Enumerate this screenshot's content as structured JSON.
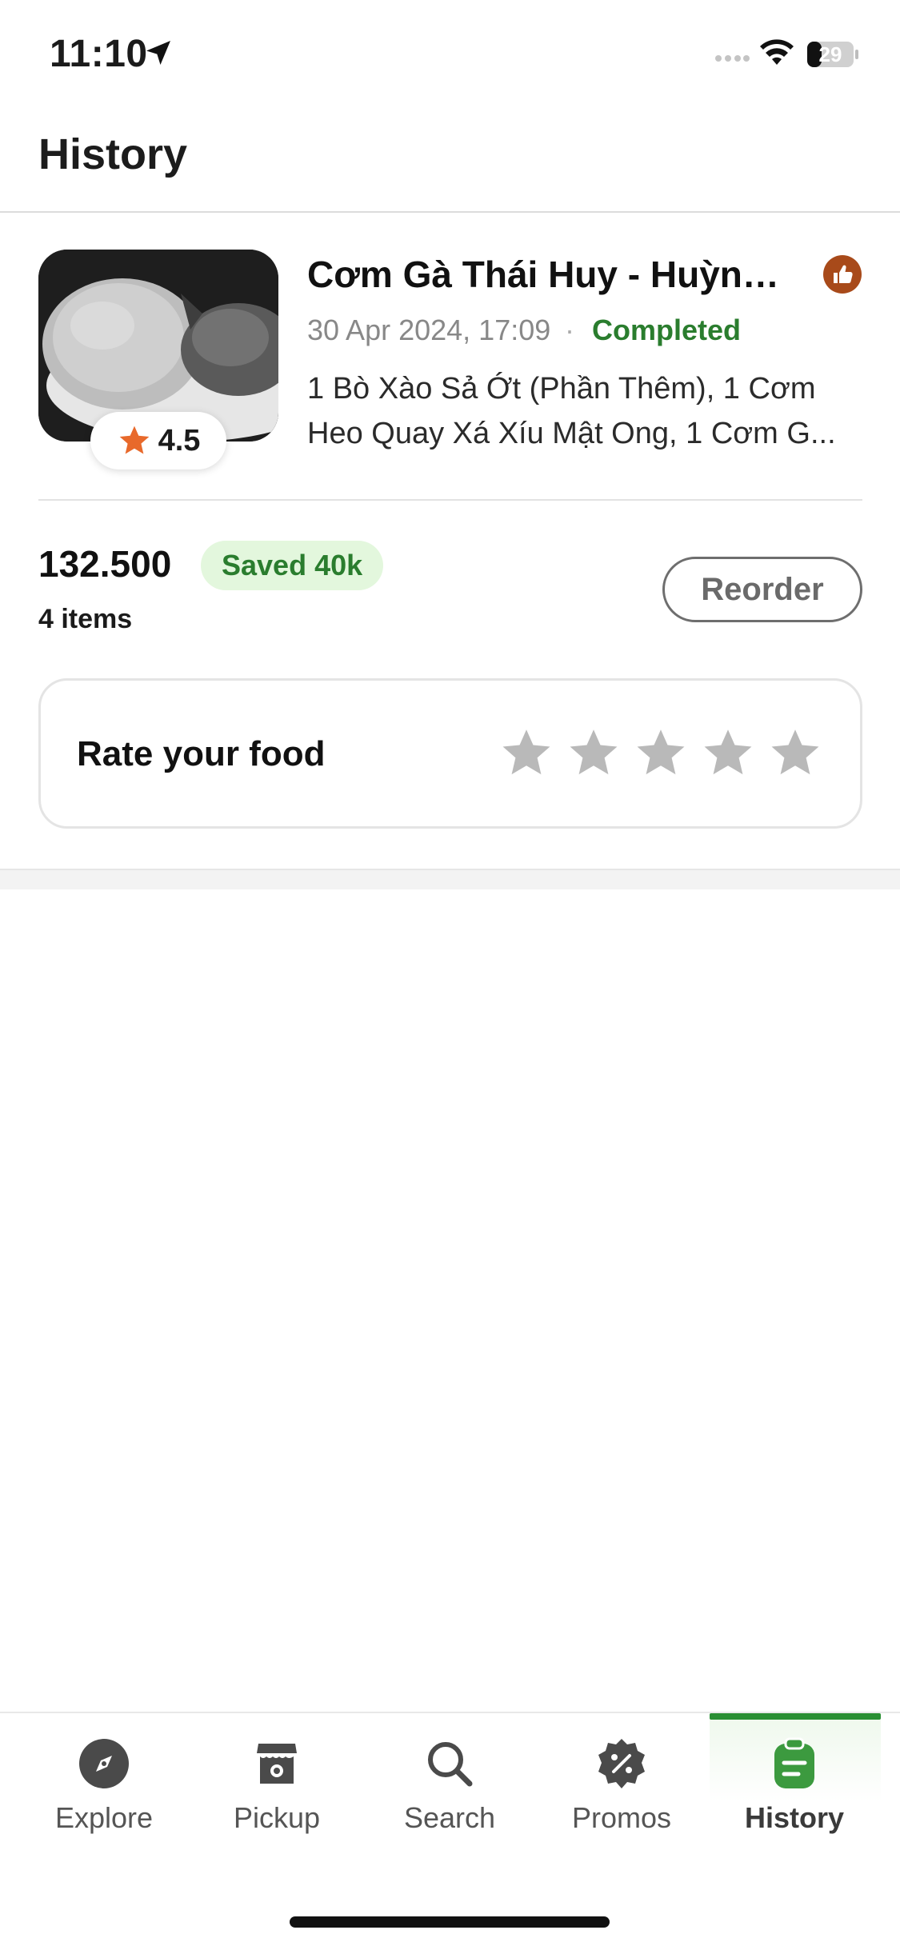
{
  "status_bar": {
    "time": "11:10",
    "battery": "29"
  },
  "header": {
    "title": "History"
  },
  "order": {
    "restaurant": "Cơm Gà Thái Huy - Huỳnh...",
    "rating": "4.5",
    "date": "30 Apr 2024, 17:09",
    "separator": "·",
    "status": "Completed",
    "items_description": "1 Bò Xào Sả Ớt (Phần Thêm), 1 Cơm Heo Quay Xá Xíu Mật Ong, 1 Cơm G...",
    "total": "132.500",
    "saved": "Saved 40k",
    "items_count": "4 items",
    "reorder_label": "Reorder",
    "rate_label": "Rate your food",
    "rate_stars": 5
  },
  "nav": {
    "items": [
      {
        "label": "Explore",
        "icon": "compass-icon"
      },
      {
        "label": "Pickup",
        "icon": "store-icon"
      },
      {
        "label": "Search",
        "icon": "search-icon"
      },
      {
        "label": "Promos",
        "icon": "percent-badge-icon"
      },
      {
        "label": "History",
        "icon": "clipboard-icon",
        "active": true
      }
    ]
  },
  "colors": {
    "accent_green": "#2a7d2e",
    "saved_bg": "#e3f7dd",
    "star_rating": "#e8692b",
    "star_empty": "#b9b9b9",
    "thumb_badge": "#a84a1a"
  }
}
